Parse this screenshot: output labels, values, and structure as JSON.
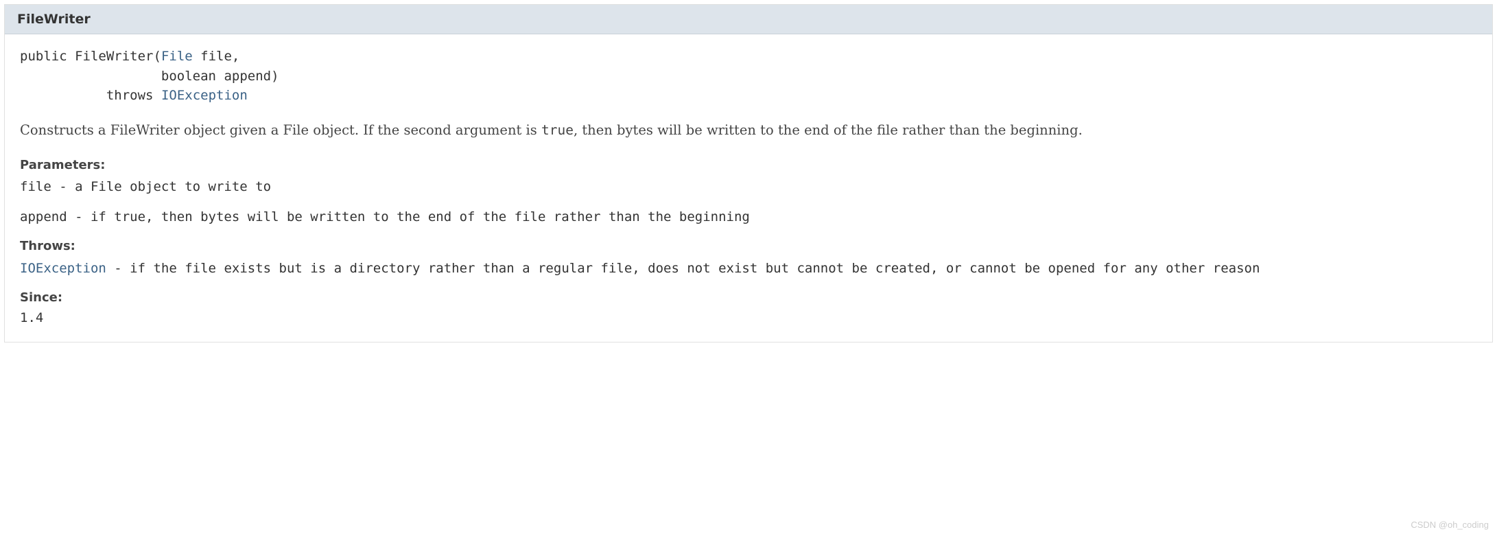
{
  "header": {
    "title": "FileWriter"
  },
  "signature": {
    "modifier": "public",
    "constructor_name": "FileWriter",
    "param1_type": "File",
    "param1_name": "file",
    "param2_type": "boolean",
    "param2_name": "append",
    "throws_keyword": "throws",
    "throws_type": "IOException"
  },
  "description": {
    "part1": "Constructs a FileWriter object given a File object. If the second argument is ",
    "code": "true",
    "part2": ", then bytes will be written to the end of the file rather than the beginning."
  },
  "parameters": {
    "label": "Parameters:",
    "items": [
      {
        "name": "file",
        "sep": " - ",
        "desc": "a File object to write to"
      },
      {
        "name": "append",
        "sep": " - ",
        "desc": "if true, then bytes will be written to the end of the file rather than the beginning"
      }
    ]
  },
  "throws": {
    "label": "Throws:",
    "type": "IOException",
    "sep": " - ",
    "desc": "if the file exists but is a directory rather than a regular file, does not exist but cannot be created, or cannot be opened for any other reason"
  },
  "since": {
    "label": "Since:",
    "value": "1.4"
  },
  "watermark": "CSDN @oh_coding"
}
